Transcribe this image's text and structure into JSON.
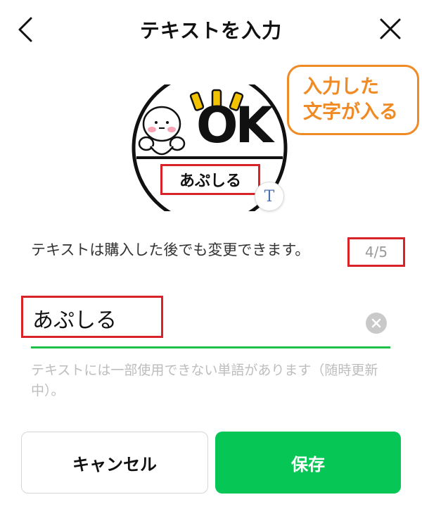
{
  "header": {
    "title": "テキストを入力",
    "back_icon": "chevron-left-icon",
    "close_icon": "close-icon"
  },
  "sticker": {
    "ok_text": "OK",
    "label": "あぷしる",
    "badge": "T"
  },
  "callout": {
    "line1": "入力した",
    "line2": "文字が入る"
  },
  "info": {
    "text": "テキストは購入した後でも変更できます。",
    "counter": "4/5"
  },
  "input": {
    "value": "あぷしる",
    "placeholder": ""
  },
  "notice": "テキストには一部使用できない単語があります（随時更新中）。",
  "buttons": {
    "cancel": "キャンセル",
    "save": "保存"
  },
  "colors": {
    "accent_green": "#06c755",
    "underline_green": "#1fbf4a",
    "highlight_red": "#d8232a",
    "callout_orange": "#f08a24"
  }
}
